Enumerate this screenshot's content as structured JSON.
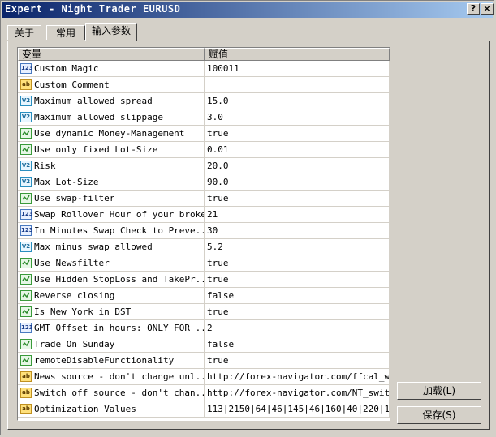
{
  "window": {
    "title": "Expert - Night Trader EURUSD",
    "help_label": "?",
    "close_label": "×"
  },
  "tabs": [
    {
      "label": "关于"
    },
    {
      "label": "常用"
    },
    {
      "label": "输入参数"
    }
  ],
  "active_tab": 2,
  "grid": {
    "headers": {
      "variable": "变量",
      "value": "赋值"
    },
    "rows": [
      {
        "name": "Custom Magic",
        "value": "100011",
        "type": "int"
      },
      {
        "name": "Custom Comment",
        "value": "",
        "type": "string"
      },
      {
        "name": "Maximum allowed spread",
        "value": "15.0",
        "type": "double"
      },
      {
        "name": "Maximum allowed slippage",
        "value": "3.0",
        "type": "double"
      },
      {
        "name": "Use dynamic Money-Management",
        "value": "true",
        "type": "bool"
      },
      {
        "name": "Use only fixed Lot-Size",
        "value": "0.01",
        "type": "bool"
      },
      {
        "name": "Risk",
        "value": "20.0",
        "type": "double"
      },
      {
        "name": "Max Lot-Size",
        "value": "90.0",
        "type": "double"
      },
      {
        "name": "Use swap-filter",
        "value": "true",
        "type": "bool"
      },
      {
        "name": "Swap Rollover Hour of your broker",
        "value": "21",
        "type": "int"
      },
      {
        "name": "In Minutes Swap Check to Preve...",
        "value": "30",
        "type": "int"
      },
      {
        "name": "Max minus swap allowed",
        "value": "5.2",
        "type": "double"
      },
      {
        "name": "Use Newsfilter",
        "value": "true",
        "type": "bool"
      },
      {
        "name": "Use Hidden StopLoss and TakePr...",
        "value": "true",
        "type": "bool"
      },
      {
        "name": "Reverse closing",
        "value": "false",
        "type": "bool"
      },
      {
        "name": "Is New York in DST",
        "value": "true",
        "type": "bool"
      },
      {
        "name": "GMT Offset in hours: ONLY FOR ...",
        "value": "2",
        "type": "int"
      },
      {
        "name": "Trade On Sunday",
        "value": "false",
        "type": "bool"
      },
      {
        "name": "remoteDisableFunctionality",
        "value": "true",
        "type": "bool"
      },
      {
        "name": "News source - don't change unl...",
        "value": "http://forex-navigator.com/ffcal_w...",
        "type": "string"
      },
      {
        "name": "Switch off source - don't chan...",
        "value": "http://forex-navigator.com/NT_swit...",
        "type": "string"
      },
      {
        "name": "Optimization Values",
        "value": "113|2150|64|46|145|46|160|40|220|1...",
        "type": "string"
      }
    ]
  },
  "buttons": {
    "load_label": "加载(L)",
    "save_label": "保存(S)"
  },
  "icons": {
    "int": "123",
    "double": "V2",
    "string": "ab",
    "bool": "bool-check-icon"
  }
}
